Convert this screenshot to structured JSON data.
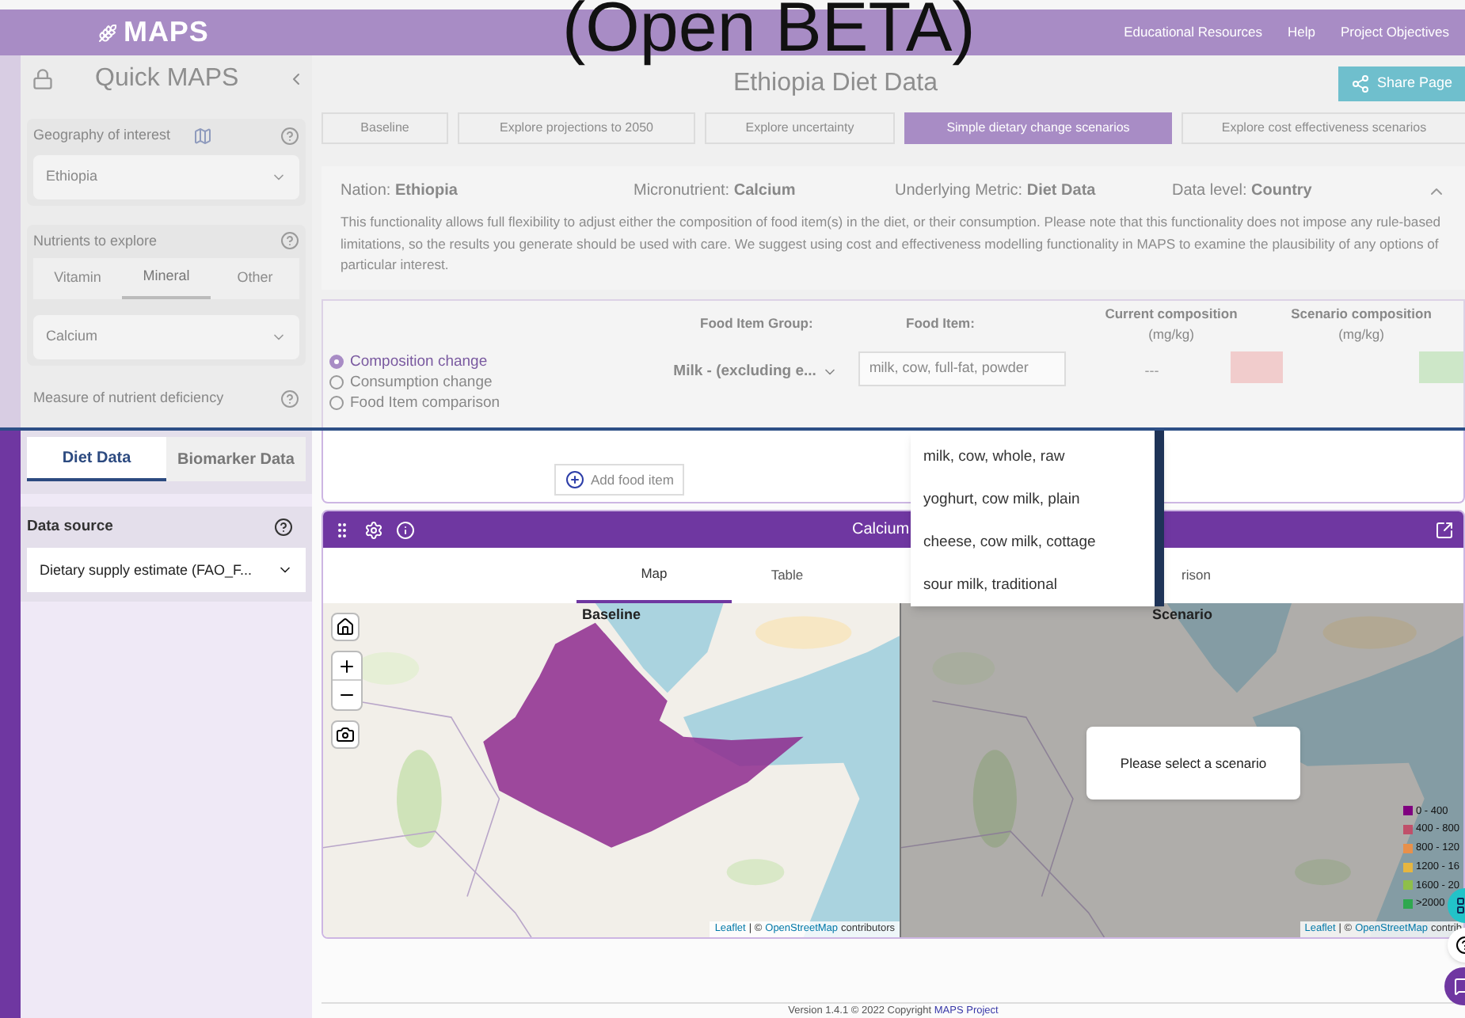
{
  "header": {
    "logo": "MAPS",
    "banner": "(Open BETA)",
    "nav": [
      "Educational Resources",
      "Help",
      "Project Objectives"
    ]
  },
  "sidebar": {
    "title": "Quick MAPS",
    "geography": {
      "label": "Geography of interest",
      "value": "Ethiopia"
    },
    "nutrients": {
      "label": "Nutrients to explore",
      "tabs": [
        {
          "label": "Vitamin",
          "selected": false
        },
        {
          "label": "Mineral",
          "selected": true
        },
        {
          "label": "Other",
          "selected": false
        }
      ],
      "value": "Calcium"
    },
    "measure": {
      "label": "Measure of nutrient deficiency",
      "tabs": [
        {
          "label": "Diet Data",
          "selected": true
        },
        {
          "label": "Biomarker Data",
          "selected": false
        }
      ]
    },
    "data_source": {
      "label": "Data source",
      "value": "Dietary supply estimate (FAO_F..."
    }
  },
  "page": {
    "title": "Ethiopia Diet Data",
    "share": "Share Page",
    "tabs": [
      {
        "label": "Baseline",
        "selected": false
      },
      {
        "label": "Explore projections to 2050",
        "selected": false
      },
      {
        "label": "Explore uncertainty",
        "selected": false
      },
      {
        "label": "Simple dietary change scenarios",
        "selected": true
      },
      {
        "label": "Explore cost effectiveness scenarios",
        "selected": false
      }
    ],
    "summary": [
      "Nation: **Ethiopia**",
      "Micronutrient: **Calcium**",
      "Underlying Metric: **Diet Data**",
      "Data level: **Country**"
    ],
    "description": "This functionality allows full flexibility to adjust either the composition of food item(s) in the diet, or their consumption. Please note that this functionality does not impose any rule-based limitations, so the results you generate should be used with care. We suggest using cost and effectiveness modelling functionality in MAPS to examine the plausibility of any options of particular interest."
  },
  "scenario": {
    "columns": [
      {
        "title": "Food Item Group:"
      },
      {
        "title": "Food Item:"
      },
      {
        "title": "Current composition",
        "unit": "(mg/kg)"
      },
      {
        "title": "Scenario composition",
        "unit": "(mg/kg)"
      }
    ],
    "modes": [
      {
        "label": "Composition change",
        "selected": true
      },
      {
        "label": "Consumption change",
        "selected": false
      },
      {
        "label": "Food Item comparison",
        "selected": false
      }
    ],
    "group": "Milk - (excluding e...",
    "food_item": "milk, cow, full-fat, powder",
    "current": "---",
    "options": [
      "milk, cow, whole, raw",
      "yoghurt, cow milk, plain",
      "cheese, cow milk, cottage",
      "sour milk, traditional"
    ],
    "add_button": "Add food item"
  },
  "map_panel": {
    "title": "Calcium",
    "tabs": [
      {
        "label": "Map",
        "selected": true
      },
      {
        "label": "Table",
        "selected": false
      },
      {
        "label": "rison",
        "selected": false
      }
    ],
    "maps": [
      {
        "label": "Baseline",
        "dimmed": false,
        "highlight": true,
        "attribution": {
          "leaflet": "Leaflet",
          "middle": "| ©",
          "osm": "OpenStreetMap",
          "suffix": "contributors"
        }
      },
      {
        "label": "Scenario",
        "dimmed": true,
        "highlight": false,
        "attribution": {
          "leaflet": "Leaflet",
          "middle": "| ©",
          "osm": "OpenStreetMap",
          "suffix": "contrib"
        }
      }
    ],
    "popup": "Please select a scenario",
    "legend": [
      {
        "label": "0 - 400",
        "color": "#800080"
      },
      {
        "label": "400 - 800",
        "color": "#c0506a"
      },
      {
        "label": "800 - 120",
        "color": "#e8904a"
      },
      {
        "label": "1200 - 16",
        "color": "#e6b640"
      },
      {
        "label": "1600 - 20",
        "color": "#8fbf4a"
      },
      {
        "label": ">2000",
        "color": "#2fa84f"
      }
    ]
  },
  "footer": {
    "text": "Version 1.4.1 © 2022 Copyright",
    "link": "MAPS Project"
  }
}
